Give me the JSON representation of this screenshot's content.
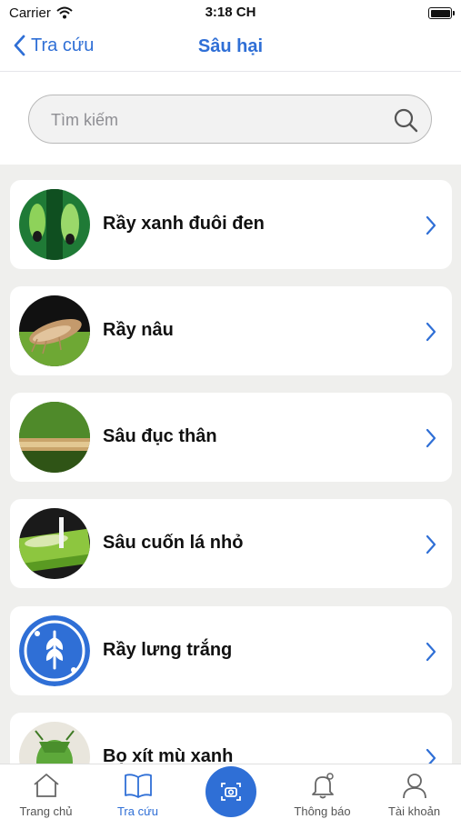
{
  "status_bar": {
    "carrier": "Carrier",
    "time": "3:18 CH"
  },
  "nav": {
    "back_label": "Tra cứu",
    "title": "Sâu hại"
  },
  "search": {
    "placeholder": "Tìm kiếm",
    "value": ""
  },
  "items": [
    {
      "label": "Rầy xanh đuôi đen"
    },
    {
      "label": "Rầy nâu"
    },
    {
      "label": "Sâu đục thân"
    },
    {
      "label": "Sâu cuốn lá nhỏ"
    },
    {
      "label": "Rầy lưng trắng"
    },
    {
      "label": "Bọ xít mù xanh"
    }
  ],
  "tabbar": {
    "home": "Trang chủ",
    "lookup": "Tra cứu",
    "notifications": "Thông báo",
    "account": "Tài khoản"
  },
  "colors": {
    "accent": "#2f6fd6",
    "list_background": "#efefed"
  }
}
